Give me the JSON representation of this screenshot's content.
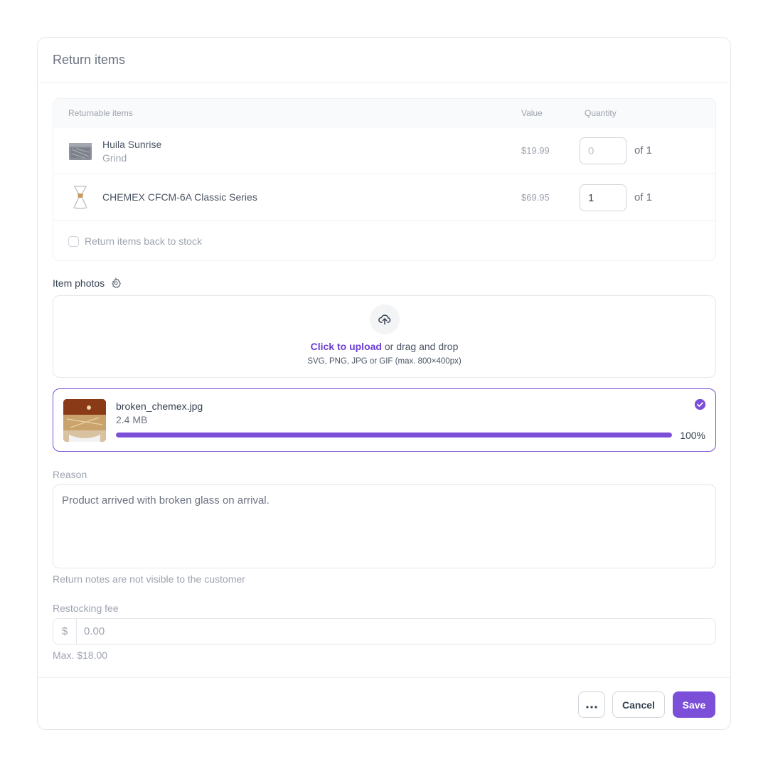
{
  "modal": {
    "title": "Return items"
  },
  "table": {
    "headers": {
      "items": "Returnable items",
      "value": "Value",
      "quantity": "Quantity"
    },
    "rows": [
      {
        "name": "Huila Sunrise",
        "variant": "Grind",
        "price": "$19.99",
        "qty_placeholder": "0",
        "qty_value": "",
        "of_label": "of 1",
        "thumb_icon": "coffee-bag-icon"
      },
      {
        "name": "CHEMEX CFCM-6A Classic Series",
        "variant": "",
        "price": "$69.95",
        "qty_placeholder": "",
        "qty_value": "1",
        "of_label": "of 1",
        "thumb_icon": "chemex-icon"
      }
    ],
    "stock_checkbox_label": "Return items back to stock",
    "stock_checked": false
  },
  "photos": {
    "label": "Item photos",
    "settings_icon": "gear-icon",
    "upload_icon": "cloud-upload-icon",
    "upload_link": "Click to upload",
    "upload_rest": " or drag and drop",
    "upload_hint": "SVG, PNG, JPG or GIF (max. 800×400px)",
    "file": {
      "name": "broken_chemex.jpg",
      "size": "2.4 MB",
      "progress": 100,
      "progress_label": "100%",
      "status_icon": "check-circle-icon"
    }
  },
  "reason": {
    "label": "Reason",
    "value": "Product arrived with broken glass on arrival.",
    "help": "Return notes are not visible to the customer"
  },
  "restocking": {
    "label": "Restocking fee",
    "prefix": "$",
    "placeholder": "0.00",
    "help": "Max. $18.00"
  },
  "footer": {
    "more_icon": "more-horizontal-icon",
    "cancel_label": "Cancel",
    "save_label": "Save"
  },
  "colors": {
    "accent": "#7c4fd9",
    "link": "#6d3fd6",
    "border": "#e5e7eb"
  }
}
